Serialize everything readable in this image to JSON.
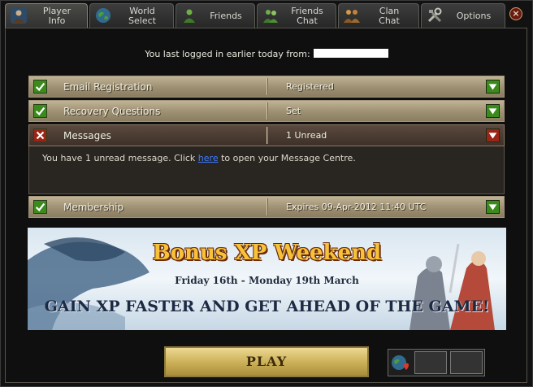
{
  "tabs": [
    {
      "label": "Player Info",
      "line1": "Player",
      "line2": "Info",
      "icon": "player-icon",
      "active": true
    },
    {
      "label": "World Select",
      "line1": "World",
      "line2": "Select",
      "icon": "globe-icon"
    },
    {
      "label": "Friends",
      "icon": "friends-icon"
    },
    {
      "label": "Friends Chat",
      "line1": "Friends",
      "line2": "Chat",
      "icon": "friends-chat-icon"
    },
    {
      "label": "Clan Chat",
      "line1": "Clan",
      "line2": "Chat",
      "icon": "clan-chat-icon"
    },
    {
      "label": "Options",
      "icon": "options-icon"
    }
  ],
  "close_label": "×",
  "last_login_text": "You last logged in earlier today from:",
  "rows": [
    {
      "label": "Email Registration",
      "value": "Registered",
      "status": "ok"
    },
    {
      "label": "Recovery Questions",
      "value": "Set",
      "status": "ok"
    },
    {
      "label": "Messages",
      "value": "1 Unread",
      "status": "alert"
    },
    {
      "label": "Membership",
      "value": "Expires 09-Apr-2012 11:40 UTC",
      "status": "ok"
    }
  ],
  "message": {
    "before": "You have 1 unread message. Click ",
    "link": "here",
    "after": " to open your Message Centre."
  },
  "banner": {
    "title": "Bonus XP Weekend",
    "subtitle": "Friday 16th - Monday 19th March",
    "tagline": "GAIN XP FASTER AND GET AHEAD OF THE GAME!"
  },
  "play_label": "PLAY",
  "colors": {
    "accent_gold": "#cdb25b",
    "ok_green": "#3a8a1c",
    "alert_red": "#9a2416",
    "link_blue": "#3f7cff"
  }
}
